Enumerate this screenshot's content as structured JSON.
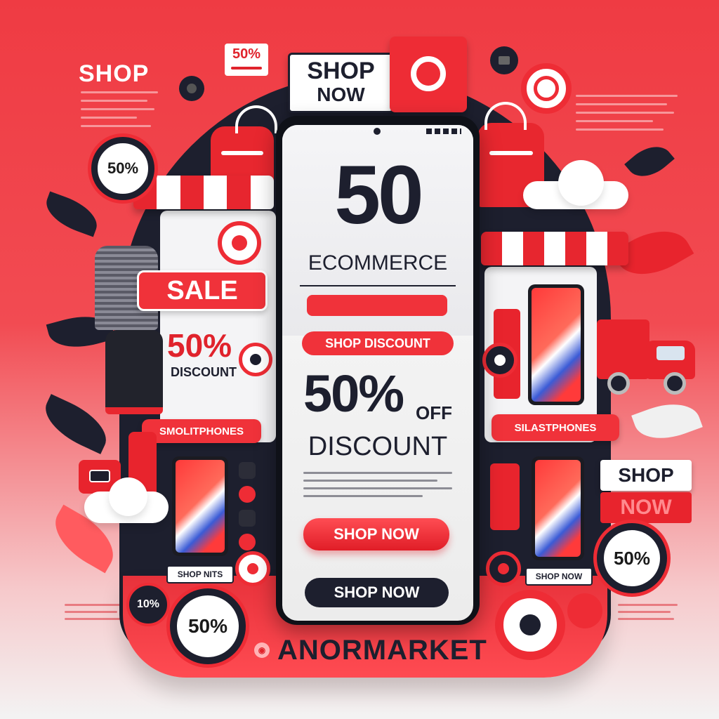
{
  "corner": {
    "shop_label": "SHOP",
    "percent_tag": "50%"
  },
  "top_sign": {
    "line1": "SHOP",
    "line2": "NOW"
  },
  "badges": {
    "left_circle": "50%",
    "right_circle": "50%",
    "bottom_circle": "50%",
    "bottom_small": "10%"
  },
  "left_panel": {
    "sale": "SALE",
    "percent": "50%",
    "discount": "DISCOUNT",
    "category": "SMOLITPHONES",
    "shop_caption": "SHOP NITS"
  },
  "right_panel": {
    "category": "SILASTPHONES",
    "shop_caption": "SHOP NOW",
    "shop_sign_line1": "SHOP",
    "shop_sign_line2": "NOW"
  },
  "phone": {
    "big_number": "50",
    "subtitle": "ECOMMERCE",
    "discount_pill": "SHOP DISCOUNT",
    "percent": "50%",
    "off": "OFF",
    "discount": "DISCOUNT",
    "cta_primary": "SHOP NOW",
    "cta_secondary": "SHOP NOW"
  },
  "brand": {
    "name": "ANORMARKET"
  },
  "colors": {
    "accent_red": "#f0323a",
    "dark_navy": "#1d1f2e",
    "white": "#ffffff"
  }
}
